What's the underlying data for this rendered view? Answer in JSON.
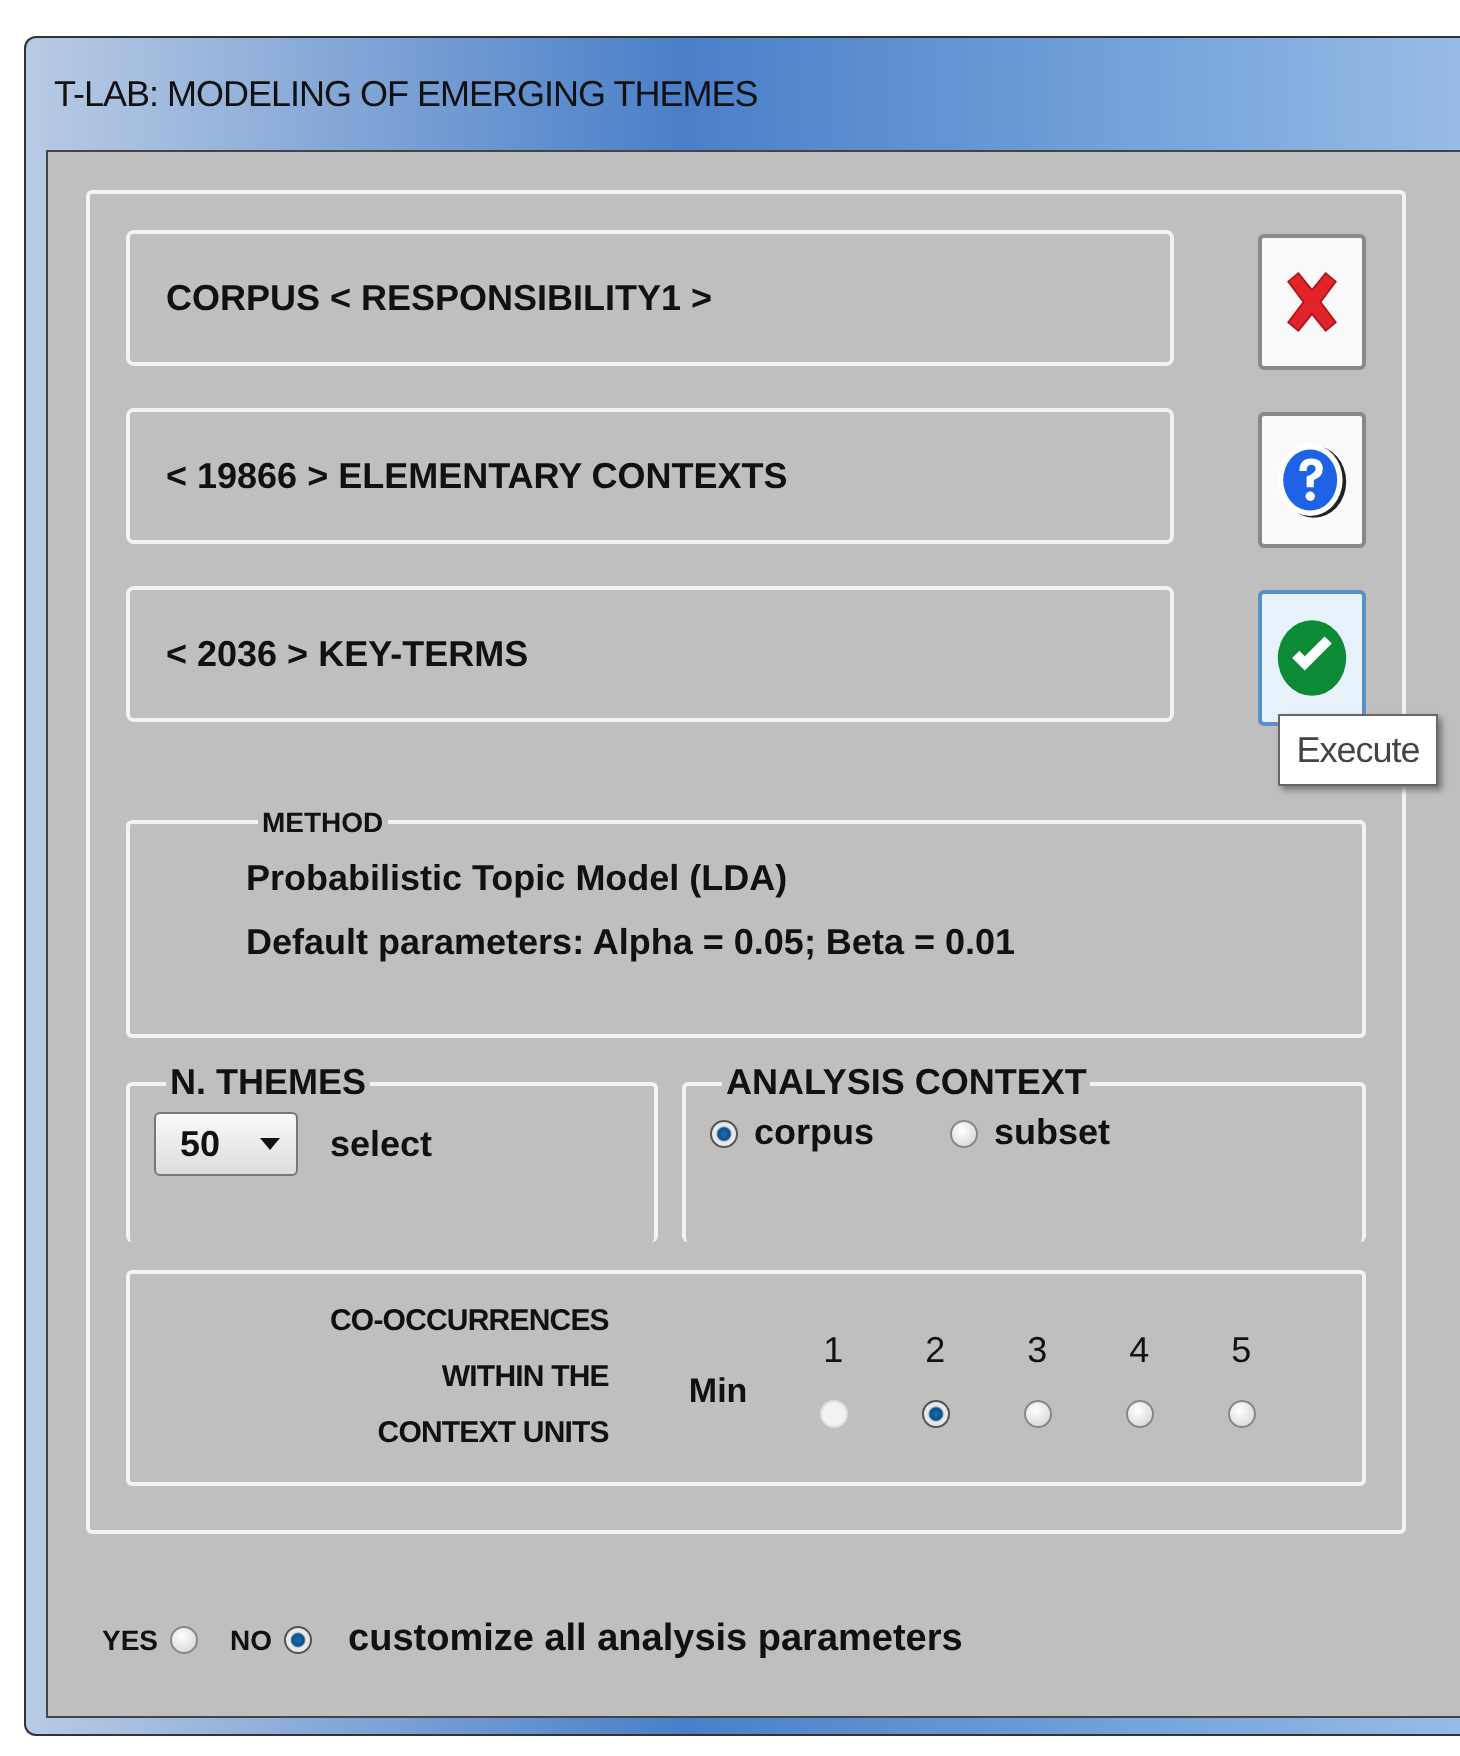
{
  "window": {
    "title": "T-LAB: MODELING OF EMERGING THEMES"
  },
  "info_boxes": [
    "CORPUS < RESPONSIBILITY1 >",
    "< 19866 > ELEMENTARY CONTEXTS",
    "< 2036 > KEY-TERMS"
  ],
  "buttons": [
    {
      "kind": "close",
      "hovered": false
    },
    {
      "kind": "help",
      "hovered": false
    },
    {
      "kind": "execute",
      "hovered": true
    }
  ],
  "tooltip": "Execute",
  "method": {
    "label": "METHOD",
    "lines": [
      "Probabilistic Topic Model (LDA)",
      "Default parameters: Alpha = 0.05; Beta = 0.01"
    ]
  },
  "n_themes": {
    "label": "N. THEMES",
    "value": "50",
    "action": "select"
  },
  "analysis_context": {
    "label": "ANALYSIS CONTEXT",
    "options": [
      {
        "label": "corpus",
        "selected": true
      },
      {
        "label": "subset",
        "selected": false
      }
    ]
  },
  "co_occurrences": {
    "label_lines": [
      "CO-OCCURRENCES",
      "WITHIN THE",
      "CONTEXT UNITS"
    ],
    "min_label": "Min",
    "options": [
      {
        "label": "1",
        "selected": false,
        "disabled": true
      },
      {
        "label": "2",
        "selected": true,
        "disabled": false
      },
      {
        "label": "3",
        "selected": false,
        "disabled": false
      },
      {
        "label": "4",
        "selected": false,
        "disabled": false
      },
      {
        "label": "5",
        "selected": false,
        "disabled": false
      }
    ]
  },
  "customize": {
    "options": [
      {
        "label": "YES",
        "selected": false
      },
      {
        "label": "NO",
        "selected": true
      }
    ],
    "text": "customize all analysis parameters"
  }
}
